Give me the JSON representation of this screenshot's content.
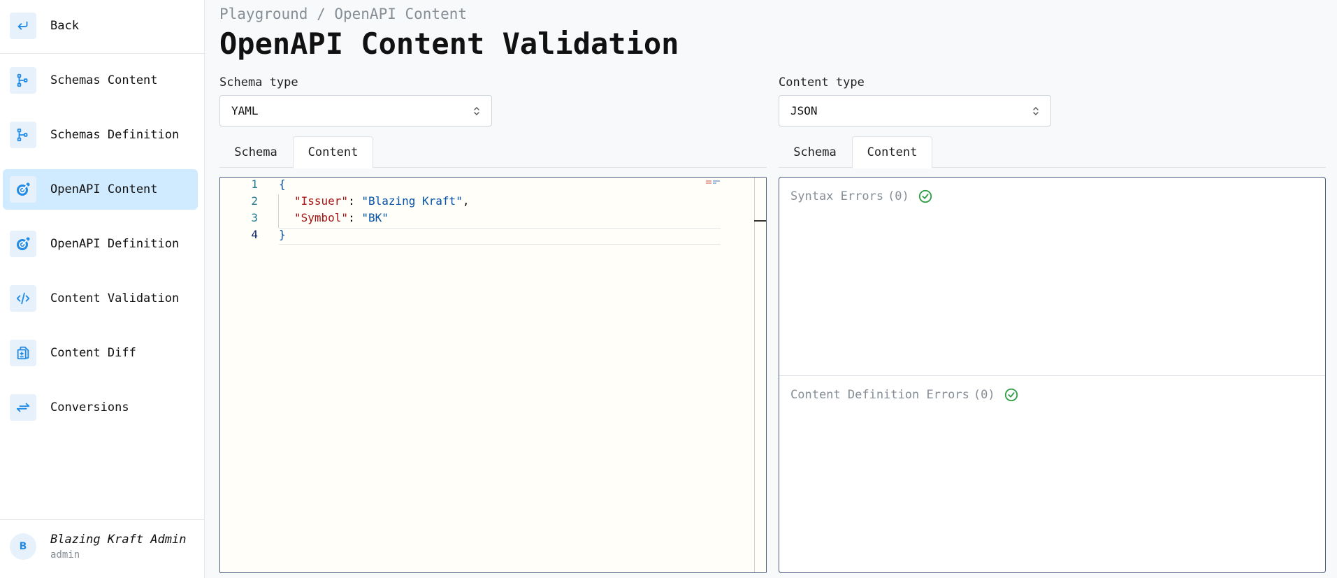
{
  "sidebar": {
    "back_label": "Back",
    "items": [
      {
        "label": "Schemas Content",
        "icon": "schema-icon",
        "active": false
      },
      {
        "label": "Schemas Definition",
        "icon": "schema-icon",
        "active": false
      },
      {
        "label": "OpenAPI Content",
        "icon": "openapi-icon",
        "active": true
      },
      {
        "label": "OpenAPI Definition",
        "icon": "openapi-icon",
        "active": false
      },
      {
        "label": "Content Validation",
        "icon": "code-icon",
        "active": false
      },
      {
        "label": "Content Diff",
        "icon": "diff-icon",
        "active": false
      },
      {
        "label": "Conversions",
        "icon": "arrows-exchange-icon",
        "active": false
      }
    ],
    "user": {
      "initial": "B",
      "name": "Blazing Kraft Admin",
      "role": "admin"
    }
  },
  "header": {
    "breadcrumb": "Playground / OpenAPI Content",
    "title": "OpenAPI Content Validation"
  },
  "left_panel": {
    "label": "Schema type",
    "select_value": "YAML",
    "tabs": [
      {
        "label": "Schema",
        "active": false
      },
      {
        "label": "Content",
        "active": true
      }
    ]
  },
  "right_panel": {
    "label": "Content type",
    "select_value": "JSON",
    "tabs": [
      {
        "label": "Schema",
        "active": false
      },
      {
        "label": "Content",
        "active": true
      }
    ]
  },
  "editor": {
    "lines": [
      {
        "n": "1",
        "text": "{"
      },
      {
        "n": "2",
        "key": "\"Issuer\"",
        "value": "\"Blazing Kraft\"",
        "trail": ","
      },
      {
        "n": "3",
        "key": "\"Symbol\"",
        "value": "\"BK\"",
        "trail": ""
      },
      {
        "n": "4",
        "text": "}"
      }
    ]
  },
  "errors": {
    "syntax_label": "Syntax Errors",
    "syntax_count": "(0)",
    "definition_label": "Content Definition Errors",
    "definition_count": "(0)"
  },
  "colors": {
    "accent": "#228be6",
    "active_bg": "#d0ebff",
    "ok": "#2f9e44"
  }
}
